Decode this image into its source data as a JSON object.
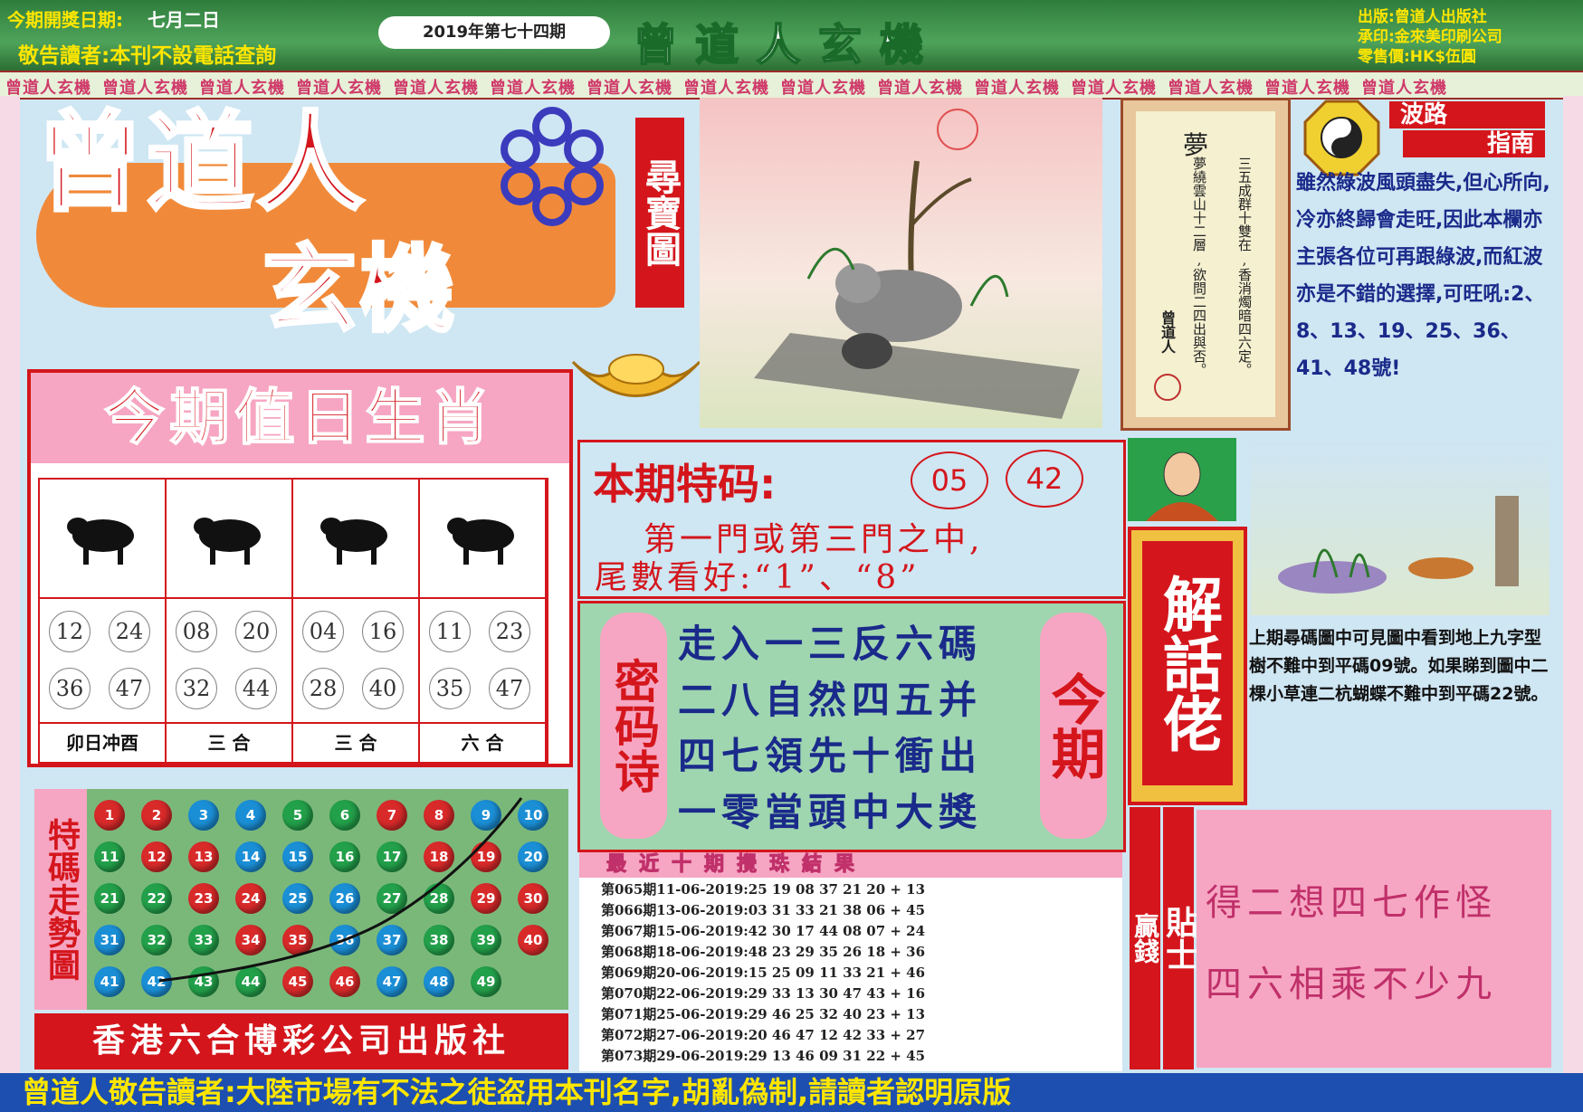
{
  "header": {
    "date_label": "今期開獎日期:",
    "date_value": "七月二日",
    "notice": "敬告讀者:本刊不設電話查詢",
    "issue": "2019年第七十四期",
    "title": "曾道人玄機",
    "publisher_label": "出版:曾道人出版社",
    "printer_label": "承印:金來美印刷公司",
    "price_label": "零售價:HK$伍圓"
  },
  "border_text": "曾道人玄機",
  "logo": {
    "line1": "曾道人",
    "line2": "玄機",
    "tag": "尋寶圖"
  },
  "zodiac": {
    "title": "今期值日生肖",
    "columns": [
      {
        "numbers": [
          "12",
          "24",
          "36",
          "47"
        ],
        "label": "卯日冲酉"
      },
      {
        "numbers": [
          "08",
          "20",
          "32",
          "44"
        ],
        "label": "三 合"
      },
      {
        "numbers": [
          "04",
          "16",
          "28",
          "40"
        ],
        "label": "三 合"
      },
      {
        "numbers": [
          "11",
          "23",
          "35",
          "47"
        ],
        "label": "六 合"
      }
    ]
  },
  "trend": {
    "title": "特碼走勢圖",
    "balls": [
      {
        "n": "1",
        "c": "r"
      },
      {
        "n": "2",
        "c": "r"
      },
      {
        "n": "3",
        "c": "b"
      },
      {
        "n": "4",
        "c": "b"
      },
      {
        "n": "5",
        "c": "g"
      },
      {
        "n": "6",
        "c": "g"
      },
      {
        "n": "7",
        "c": "r"
      },
      {
        "n": "8",
        "c": "r"
      },
      {
        "n": "9",
        "c": "b"
      },
      {
        "n": "10",
        "c": "b"
      },
      {
        "n": "11",
        "c": "g"
      },
      {
        "n": "12",
        "c": "r"
      },
      {
        "n": "13",
        "c": "r"
      },
      {
        "n": "14",
        "c": "b"
      },
      {
        "n": "15",
        "c": "b"
      },
      {
        "n": "16",
        "c": "g"
      },
      {
        "n": "17",
        "c": "g"
      },
      {
        "n": "18",
        "c": "r"
      },
      {
        "n": "19",
        "c": "r"
      },
      {
        "n": "20",
        "c": "b"
      },
      {
        "n": "21",
        "c": "g"
      },
      {
        "n": "22",
        "c": "g"
      },
      {
        "n": "23",
        "c": "r"
      },
      {
        "n": "24",
        "c": "r"
      },
      {
        "n": "25",
        "c": "b"
      },
      {
        "n": "26",
        "c": "b"
      },
      {
        "n": "27",
        "c": "g"
      },
      {
        "n": "28",
        "c": "g"
      },
      {
        "n": "29",
        "c": "r"
      },
      {
        "n": "30",
        "c": "r"
      },
      {
        "n": "31",
        "c": "b"
      },
      {
        "n": "32",
        "c": "g"
      },
      {
        "n": "33",
        "c": "g"
      },
      {
        "n": "34",
        "c": "r"
      },
      {
        "n": "35",
        "c": "r"
      },
      {
        "n": "36",
        "c": "b"
      },
      {
        "n": "37",
        "c": "b"
      },
      {
        "n": "38",
        "c": "g"
      },
      {
        "n": "39",
        "c": "g"
      },
      {
        "n": "40",
        "c": "r"
      },
      {
        "n": "41",
        "c": "b"
      },
      {
        "n": "42",
        "c": "b"
      },
      {
        "n": "43",
        "c": "g"
      },
      {
        "n": "44",
        "c": "g"
      },
      {
        "n": "45",
        "c": "r"
      },
      {
        "n": "46",
        "c": "r"
      },
      {
        "n": "47",
        "c": "b"
      },
      {
        "n": "48",
        "c": "b"
      },
      {
        "n": "49",
        "c": "g"
      }
    ]
  },
  "publisher_footer": "香港六合博彩公司出版社",
  "special": {
    "label": "本期特码:",
    "num1": "05",
    "num2": "42",
    "line1": "第一門或第三門之中,",
    "line2": "尾數看好:“1”、“8”"
  },
  "poem": {
    "tag": "密码诗",
    "lines": [
      "走入一三反六碼",
      "二八自然四五并",
      "四七領先十衝出",
      "一零當頭中大獎"
    ],
    "tag2": "今期"
  },
  "history": {
    "title": "最近十期攪珠結果",
    "rows": [
      "第065期11-06-2019:25 19 08 37 21 20 + 13",
      "第066期13-06-2019:03 31 33 21 38 06 + 45",
      "第067期15-06-2019:42 30 17 44 08 07 + 24",
      "第068期18-06-2019:48 23 29 35 26 18 + 36",
      "第069期20-06-2019:15 25 09 11 33 21 + 46",
      "第070期22-06-2019:29 33 13 30 47 43 + 16",
      "第071期25-06-2019:29 46 25 32 40 23 + 13",
      "第072期27-06-2019:20 46 47 12 42 33 + 27",
      "第073期29-06-2019:29 13 46 09 31 22 + 45"
    ]
  },
  "dream": {
    "title": "夢",
    "col1": "三五成群十雙在,香消燭暗四六定。",
    "col2": "夢繞雲山十二層,欲問二四出與否。",
    "signature": "曾道人"
  },
  "wave": {
    "title1": "波路",
    "title2": "指南",
    "text": "雖然綠波風頭盡失,但心所向,冷亦終歸會走旺,因此本欄亦主張各位可再跟綠波,而紅波亦是不錯的選擇,可旺吼:2、8、13、19、25、36、41、48號!"
  },
  "jiehua": {
    "title": "解話佬",
    "text": "上期尋碼圖中可見圖中看到地上九字型樹不難中到平碼09號。如果睇到圖中二棵小草連二杭蝴蝶不難中到平碼22號。"
  },
  "tips": {
    "label1": "贏錢",
    "label2": "貼士",
    "line1": "得二想四七作怪",
    "line2": "四六相乘不少九"
  },
  "bottom_notice": "曾道人敬告讀者:大陸市場有不法之徒盗用本刊名字,胡亂偽制,請讀者認明原版"
}
